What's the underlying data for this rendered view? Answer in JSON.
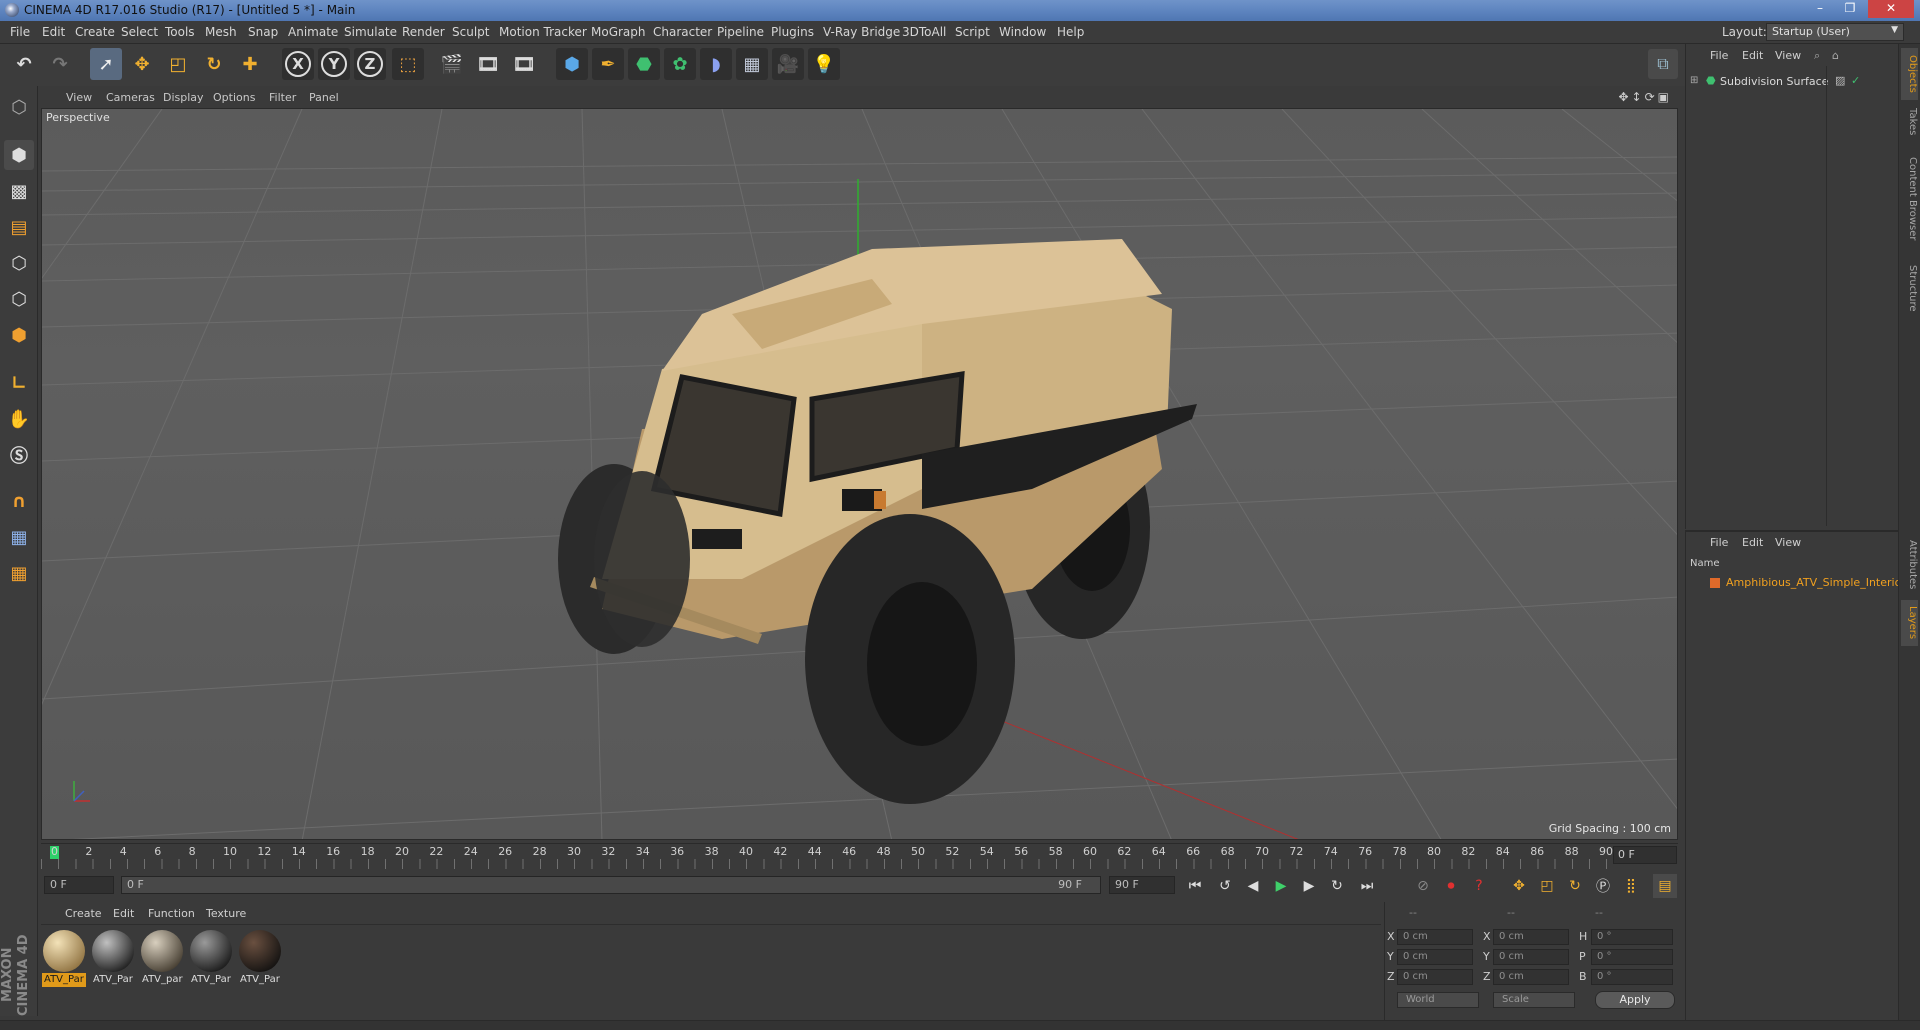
{
  "window": {
    "title": "CINEMA 4D R17.016 Studio (R17) - [Untitled 5 *] - Main",
    "minimize": "–",
    "restore": "❐",
    "close": "✕"
  },
  "menubar": {
    "items": [
      "File",
      "Edit",
      "Create",
      "Select",
      "Tools",
      "Mesh",
      "Snap",
      "Animate",
      "Simulate",
      "Render",
      "Sculpt",
      "Motion Tracker",
      "MoGraph",
      "Character",
      "Pipeline",
      "Plugins",
      "V-Ray Bridge",
      "3DToAll",
      "Script",
      "Window",
      "Help"
    ],
    "layout_label": "Layout:",
    "layout_value": "Startup (User)"
  },
  "toolbar": {
    "axis_x": "X",
    "axis_y": "Y",
    "axis_z": "Z"
  },
  "viewport": {
    "menu": [
      "View",
      "Cameras",
      "Display",
      "Options",
      "Filter",
      "Panel"
    ],
    "label": "Perspective",
    "grid_spacing": "Grid Spacing : 100 cm"
  },
  "timeline": {
    "ticks": [
      "0",
      "2",
      "4",
      "6",
      "8",
      "10",
      "12",
      "14",
      "16",
      "18",
      "20",
      "22",
      "24",
      "26",
      "28",
      "30",
      "32",
      "34",
      "36",
      "38",
      "40",
      "42",
      "44",
      "46",
      "48",
      "50",
      "52",
      "54",
      "56",
      "58",
      "60",
      "62",
      "64",
      "66",
      "68",
      "70",
      "72",
      "74",
      "76",
      "78",
      "80",
      "82",
      "84",
      "86",
      "88",
      "90"
    ],
    "current_frame": "0 F",
    "start_field": "0 F",
    "range_start": "0 F",
    "range_end": "90 F",
    "end_field": "90 F"
  },
  "materials": {
    "menu": [
      "Create",
      "Edit",
      "Function",
      "Texture"
    ],
    "items": [
      {
        "label": "ATV_Par",
        "color_a": "#f3e2b8",
        "color_b": "#8a6c3a",
        "active": true
      },
      {
        "label": "ATV_Par",
        "color_a": "#c0c0c0",
        "color_b": "#141414",
        "active": false
      },
      {
        "label": "ATV_par",
        "color_a": "#d8cfbe",
        "color_b": "#3c3428",
        "active": false
      },
      {
        "label": "ATV_Par",
        "color_a": "#9a9a9a",
        "color_b": "#121212",
        "active": false
      },
      {
        "label": "ATV_Par",
        "color_a": "#6a5040",
        "color_b": "#0e0e0e",
        "active": false
      }
    ]
  },
  "coordinates": {
    "header_a": "--",
    "header_b": "--",
    "header_c": "--",
    "rows": [
      {
        "a_label": "X",
        "a_val": "0 cm",
        "b_label": "X",
        "b_val": "0 cm",
        "c_label": "H",
        "c_val": "0 °"
      },
      {
        "a_label": "Y",
        "a_val": "0 cm",
        "b_label": "Y",
        "b_val": "0 cm",
        "c_label": "P",
        "c_val": "0 °"
      },
      {
        "a_label": "Z",
        "a_val": "0 cm",
        "b_label": "Z",
        "b_val": "0 cm",
        "c_label": "B",
        "c_val": "0 °"
      }
    ],
    "space": "World",
    "mode": "Scale",
    "apply": "Apply"
  },
  "object_manager": {
    "menu": [
      "File",
      "Edit",
      "View"
    ],
    "object_name": "Subdivision Surface"
  },
  "layer_manager": {
    "menu": [
      "File",
      "Edit",
      "View"
    ],
    "name_header": "Name",
    "layer_name": "Amphibious_ATV_Simple_Interior",
    "layer_color": "#e06a2a"
  },
  "side_tabs": [
    "Objects",
    "Takes",
    "Content Browser",
    "Structure",
    "Attributes",
    "Layers"
  ],
  "colors": {
    "accent": "#e09a1a",
    "vehicle_body": "#d6b989",
    "tire": "#2a2a2a"
  }
}
